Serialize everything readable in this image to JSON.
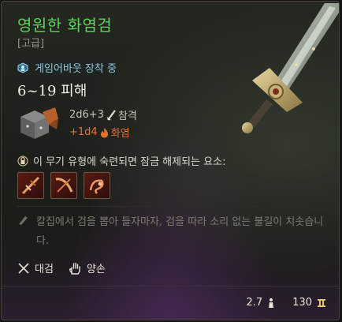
{
  "item": {
    "name": "영원한 화염검",
    "rarity": "[고급]",
    "equip_status": "게임어바웃 장착 중",
    "damage": "6~19 피해",
    "damage_dice": "2d6+3",
    "damage_type": "참격",
    "bonus_dice": "+1d4",
    "bonus_type": "화염",
    "unlock_text": "이 무기 유형에 숙련되면 잠금 해제되는 요소:",
    "flavor_text": "칼집에서 검을 뽑아 들자마자, 검을 따라 소리 없는 불길이 치솟습니다.",
    "properties": [
      {
        "label": "대검",
        "icon": "crossed-swords-icon"
      },
      {
        "label": "양손",
        "icon": "hand-icon"
      }
    ],
    "weight": "2.7",
    "value": "130"
  },
  "colors": {
    "name": "#5fd15a",
    "equip": "#8ec6e0",
    "fire": "#e2732e"
  }
}
